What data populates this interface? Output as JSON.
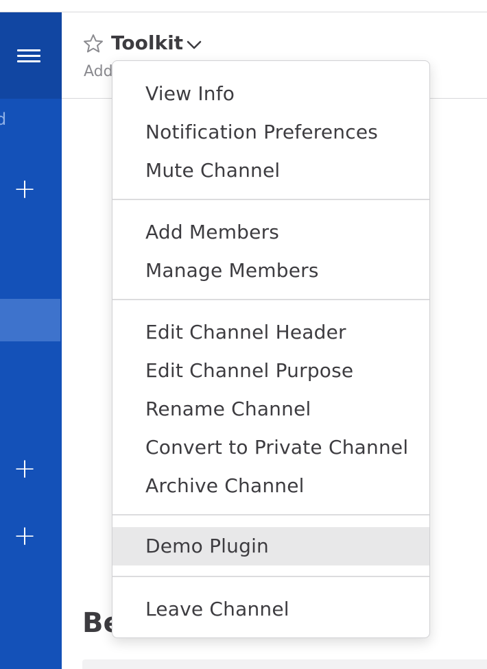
{
  "sidebar": {
    "partial_text": "d"
  },
  "header": {
    "channel_name": "Toolkit",
    "subtitle_partial": "Add"
  },
  "main": {
    "intro_title_partial": "Beginning"
  },
  "menu": {
    "group1": [
      "View Info",
      "Notification Preferences",
      "Mute Channel"
    ],
    "group2": [
      "Add Members",
      "Manage Members"
    ],
    "group3": [
      "Edit Channel Header",
      "Edit Channel Purpose",
      "Rename Channel",
      "Convert to Private Channel",
      "Archive Channel"
    ],
    "group4": [
      "Demo Plugin"
    ],
    "group5": [
      "Leave Channel"
    ]
  },
  "colors": {
    "sidebar": "#1451b8",
    "sidebar_header": "#1146a2",
    "active_item": "#3e73cc",
    "hover": "#e8e8e9"
  }
}
